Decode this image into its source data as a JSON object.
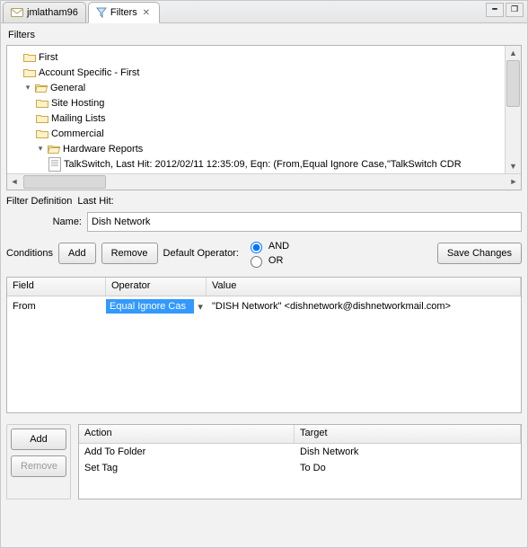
{
  "tabs": {
    "inactive_label": "jmlatham96",
    "active_label": "Filters"
  },
  "filters_title": "Filters",
  "tree": {
    "n0": "First",
    "n1": "Account Specific - First",
    "n2": "General",
    "n3": "Site Hosting",
    "n4": "Mailing Lists",
    "n5": "Commercial",
    "n6": "Hardware Reports",
    "n7": "TalkSwitch, Last Hit: 2012/02/11 12:35:09, Eqn: (From,Equal Ignore Case,\"TalkSwitch CDR"
  },
  "definition": {
    "label": "Filter Definition",
    "lasthit_label": "Last Hit:",
    "name_label": "Name:",
    "name_value": "Dish Network"
  },
  "conditions": {
    "label": "Conditions",
    "add": "Add",
    "remove": "Remove",
    "default_op_label": "Default Operator:",
    "and": "AND",
    "or": "OR",
    "save": "Save Changes",
    "headers": {
      "field": "Field",
      "operator": "Operator",
      "value": "Value"
    },
    "row": {
      "field": "From",
      "operator": "Equal Ignore Cas",
      "value": "\"DISH Network\" <dishnetwork@dishnetworkmail.com>"
    }
  },
  "actions": {
    "add": "Add",
    "remove": "Remove",
    "headers": {
      "action": "Action",
      "target": "Target"
    },
    "rows": [
      {
        "action": "Add To Folder",
        "target": "Dish Network"
      },
      {
        "action": "Set Tag",
        "target": "To Do"
      }
    ]
  }
}
